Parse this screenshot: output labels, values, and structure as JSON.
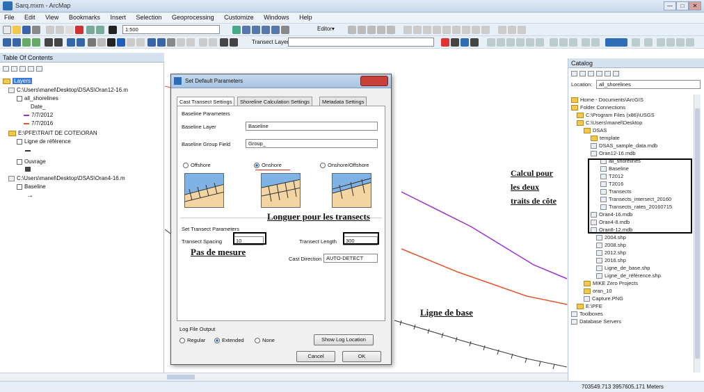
{
  "window": {
    "title": "Sarq.mxm - ArcMap",
    "minimize": "—",
    "maximize": "□",
    "close": "✕"
  },
  "menu": [
    "File",
    "Edit",
    "View",
    "Bookmarks",
    "Insert",
    "Selection",
    "Geoprocessing",
    "Customize",
    "Windows",
    "Help"
  ],
  "toolbar": {
    "scale": "1:500",
    "editor": "Editor▾",
    "transect_layer": "Transect Layer"
  },
  "toc": {
    "title": "Table Of Contents",
    "layers_root": "Layers",
    "items": [
      "C:\\Users\\manel\\Desktop\\DSAS\\Oran12-16.m",
      "all_shorelines",
      "Date_",
      "7/7/2012",
      "7/7/2016",
      "E:\\PFE\\TRAIT DE COTE\\ORAN",
      "Ligne de référence",
      "Ouvrage",
      "C:\\Users\\manel\\Desktop\\DSAS\\Oran4-16.m",
      "Baseline"
    ]
  },
  "catalog": {
    "title": "Catalog",
    "location_label": "Location:",
    "location_value": "all_shorelines",
    "items": [
      "Home - Documents\\ArcGIS",
      "Folder Connections",
      "C:\\Program Files (x86)\\USGS",
      "C:\\Users\\manel\\Desktop",
      "DSAS",
      "template",
      "DSAS_sample_data.mdb",
      "Oran12-16.mdb",
      "all_shorelines",
      "Baseline",
      "T2012",
      "T2016",
      "Transects",
      "Transects_intersect_20160",
      "Transects_rates_20160715",
      "Oran4-16.mdb",
      "Oran4-8.mdb",
      "Oran8-12.mdb",
      "2004.shp",
      "2008.shp",
      "2012.shp",
      "2016.shp",
      "Ligne_de_base.shp",
      "Ligne_de_référence.shp",
      "MIKE Zero Projects",
      "oran_10",
      "Capture.PNG",
      "E:\\PFE",
      "Toolboxes",
      "Database Servers"
    ]
  },
  "dialog": {
    "title": "Set Default Parameters",
    "tabs": [
      "Cast Transect Settings",
      "Shoreline Calculation Settings",
      "Metadata Settings"
    ],
    "baseline_params": "Baseline Parameters",
    "baseline_layer_label": "Baseline Layer",
    "baseline_layer_value": "Baseline",
    "group_field_label": "Baseline Group Field",
    "group_field_value": "Group_",
    "radio_offshore": "Offshore",
    "radio_onshore": "Onshore",
    "radio_both": "Onshore/Offshore",
    "transect_params": "Set Transect Parameters",
    "spacing_label": "Transect Spacing",
    "spacing_value": "10",
    "length_label": "Transect Length",
    "length_value": "300",
    "direction_label": "Cast Direction",
    "direction_value": "AUTO-DETECT",
    "log_label": "Log File Output",
    "log_regular": "Regular",
    "log_extended": "Extended",
    "log_none": "None",
    "show_log": "Show Log Location",
    "cancel": "Cancel",
    "ok": "OK"
  },
  "annotations": {
    "calcul": [
      "Calcul pour",
      "les deux",
      "traits de côte"
    ],
    "longueur": "Longuer pour les transects",
    "pas": "Pas de mesure",
    "ligne": "Ligne de base"
  },
  "status": {
    "coords": "703549.713  3957605.171 Meters"
  },
  "colors": {
    "purple_line": "#9b30d9",
    "orange_line": "#e8532b",
    "accent": "#2d6db5"
  }
}
